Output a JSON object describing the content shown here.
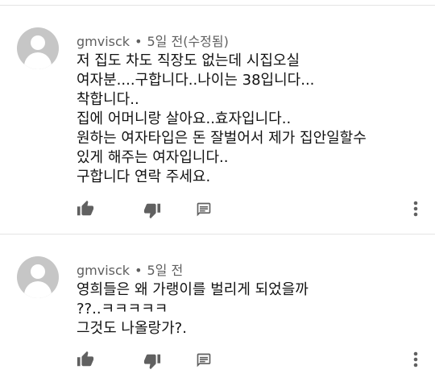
{
  "comments": [
    {
      "author": "gmvisck",
      "separator": "•",
      "time": "5일 전(수정됨)",
      "lines": [
        "저 집도 차도 직장도 없는데 시집오실",
        "여자분....구합니다..나이는 38입니다...",
        "착합니다..",
        "집에 어머니랑 살아요..효자입니다..",
        "원하는 여자타입은 돈 잘벌어서 제가 집안일할수",
        "있게 해주는 여자입니다..",
        "구합니다 연락 주세요."
      ]
    },
    {
      "author": "gmvisck",
      "separator": "•",
      "time": "5일 전",
      "lines": [
        "영희들은 왜 가랭이를 벌리게 되었을까",
        "??..ㅋㅋㅋㅋㅋ",
        "그것도 나올랑가?."
      ]
    }
  ],
  "icons": {
    "like": "thumbs-up-icon",
    "dislike": "thumbs-down-icon",
    "reply": "comment-reply-icon",
    "more": "more-vertical-icon"
  },
  "colors": {
    "icon": "#606060",
    "meta": "#5f5f5f",
    "avatar": "#c6c6c6"
  }
}
